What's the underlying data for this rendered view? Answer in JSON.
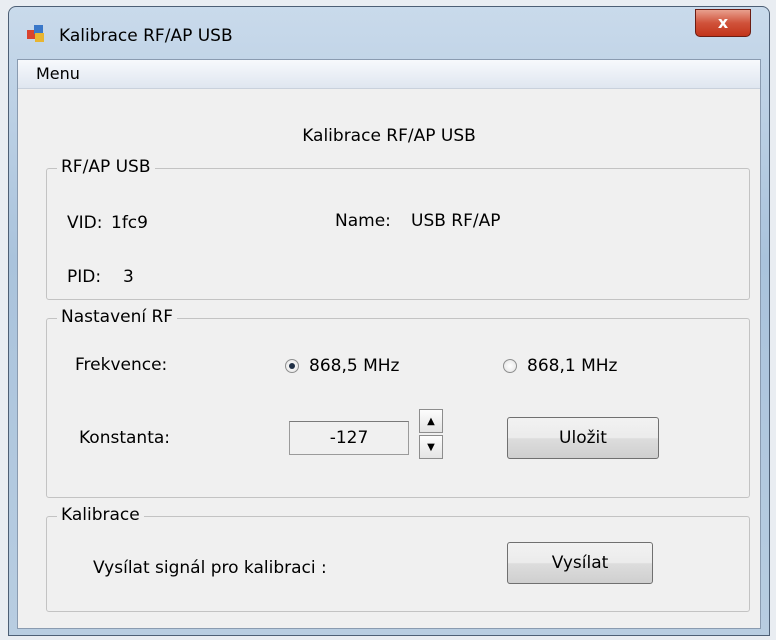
{
  "window": {
    "title": "Kalibrace RF/AP USB",
    "close_label": "x"
  },
  "menu": {
    "items": [
      "Menu"
    ]
  },
  "heading": "Kalibrace RF/AP USB",
  "device_group": {
    "legend": "RF/AP USB",
    "vid_label": "VID:",
    "vid_value": "1fc9",
    "pid_label": "PID:",
    "pid_value": "3",
    "name_label": "Name:",
    "name_value": "USB RF/AP"
  },
  "rf_group": {
    "legend": "Nastavení RF",
    "frequency_label": "Frekvence:",
    "options": [
      {
        "label": "868,5 MHz",
        "checked": true
      },
      {
        "label": "868,1 MHz",
        "checked": false
      }
    ],
    "constant_label": "Konstanta:",
    "constant_value": "-127",
    "save_label": "Uložit"
  },
  "calibration_group": {
    "legend": "Kalibrace",
    "prompt": "Vysílat signál pro kalibraci :",
    "send_label": "Vysílat"
  }
}
